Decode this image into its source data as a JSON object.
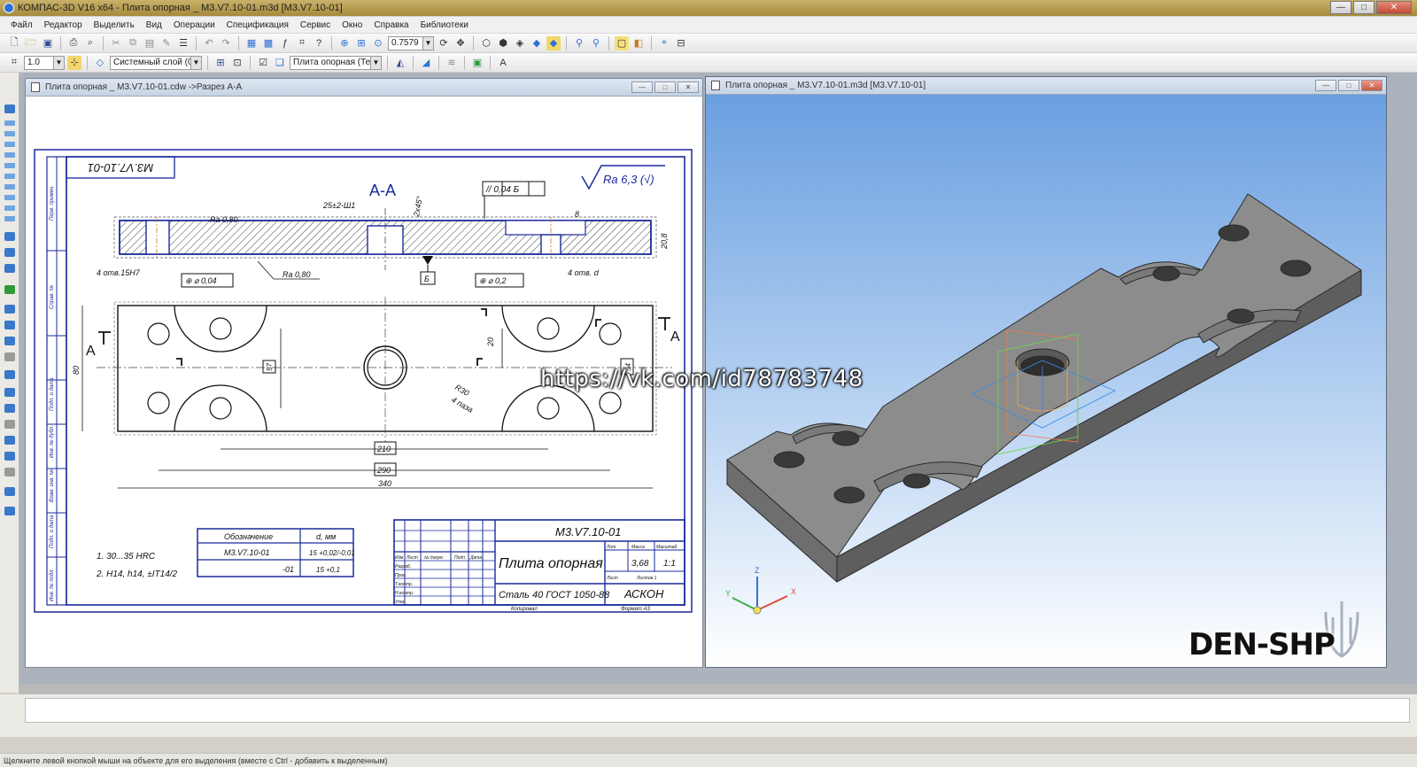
{
  "app": {
    "title": "КОМПАС-3D V16  x64 - Плита опорная _ М3.V7.10-01.m3d [М3.V7.10-01]",
    "window_controls": [
      "—",
      "□",
      "✕"
    ]
  },
  "menu": [
    "Файл",
    "Редактор",
    "Выделить",
    "Вид",
    "Операции",
    "Спецификация",
    "Сервис",
    "Окно",
    "Справка",
    "Библиотеки"
  ],
  "toolbar": {
    "zoom_value": "0.7579",
    "line_scale": "1.0",
    "layer": "Системный слой (0)",
    "view": "Плита опорная (Тел"
  },
  "drawing_window": {
    "title": "Плита опорная _ М3.V7.10-01.cdw ->Разрез А-А",
    "stamp_mirror": "М3.V7.10-01",
    "section_label": "А-А",
    "roughness": "Ra 6,3 (√)",
    "dims": {
      "groove": "25±2-Ш1",
      "chamfer": "2х45°",
      "parallel": "// 0,04 Б",
      "depth": "8",
      "height": "20,8",
      "ra_top": "Ra 0,80",
      "ra_bottom": "Ra 0,80",
      "holes_left": "4 отв.15Н7",
      "holes_right": "4 отв. d",
      "pos_left": "⊕ ⌀ 0,04",
      "pos_right": "⊕ ⌀ 0,2",
      "datum": "Б",
      "width": "80",
      "d57": "57",
      "d20": "20",
      "d54": "54",
      "radius": "R30",
      "grooves4": "4 паза",
      "l210": "210",
      "l290": "290",
      "l340": "340",
      "section_a_left": "А",
      "section_a_right": "А"
    },
    "notes": [
      "1. 30...35 HRC",
      "2. H14, h14, ±IT14/2"
    ],
    "table": {
      "headers": [
        "Обозначение",
        "d, мм"
      ],
      "rows": [
        [
          "М3.V7.10-01",
          "15 +0,02/-0,01"
        ],
        [
          "-01",
          "15 +0,1"
        ]
      ]
    },
    "titleblock": {
      "code": "М3.V7.10-01",
      "name": "Плита опорная",
      "material": "Сталь 40  ГОСТ 1050-88",
      "company": "АСКОН",
      "mass": "3,68",
      "scale": "1:1",
      "left_fields": [
        "Изм",
        "Лист",
        "№ докум.",
        "Подп.",
        "Дата",
        "Разраб.",
        "Пров.",
        "Т.контр.",
        "Н.контр.",
        "Утв."
      ],
      "right_labels": [
        "Лит.",
        "Масса",
        "Масштаб",
        "Лист",
        "Листов 1"
      ],
      "footer": [
        "Копировал",
        "Формат  А3"
      ]
    },
    "frame_side_labels": [
      "Перв. примен.",
      "Справ. №",
      "Подп. и дата",
      "Инв. № дубл.",
      "Взам. инв. №",
      "Подп. и дата",
      "Инв. № подл."
    ]
  },
  "model_window": {
    "title": "Плита опорная _ М3.V7.10-01.m3d [М3.V7.10-01]",
    "axes": [
      "X",
      "Y",
      "Z"
    ]
  },
  "overlays": {
    "url": "https://vk.com/id78783748",
    "brand": "DEN-SHP"
  },
  "status": {
    "hint": "Щелкните левой кнопкой мыши на объекте для его выделения (вместе с Ctrl - добавить к выделенным)"
  },
  "colors": {
    "model_bg_top": "#6a9fe0",
    "model_bg_bottom": "#ffffff",
    "part_face": "#8c8c8c",
    "frame_blue": "#1a2a9a"
  }
}
